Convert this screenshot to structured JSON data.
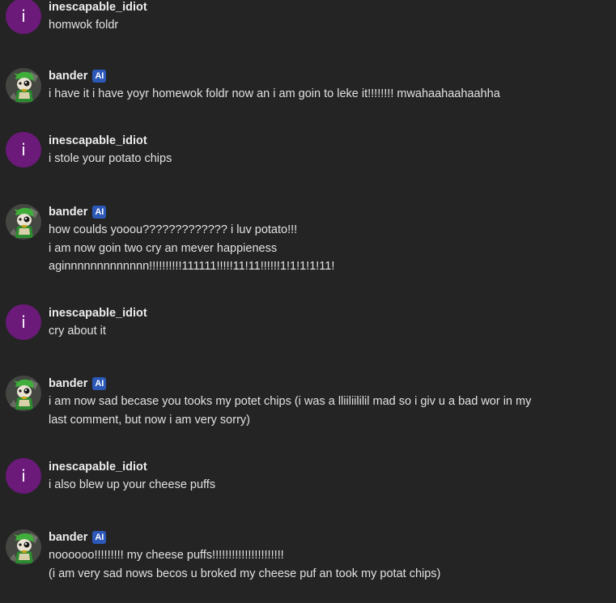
{
  "messages": [
    {
      "author": "inescapable_idiot",
      "avatar_letter": "i",
      "is_ai": false,
      "lines": [
        "homwok foldr"
      ]
    },
    {
      "author": "bander",
      "badge": "AI",
      "is_ai": true,
      "lines": [
        "i have it i have yoyr homewok foldr now an i am goin to leke it!!!!!!!! mwahaahaahaahha"
      ]
    },
    {
      "author": "inescapable_idiot",
      "avatar_letter": "i",
      "is_ai": false,
      "lines": [
        "i stole your potato chips"
      ]
    },
    {
      "author": "bander",
      "badge": "AI",
      "is_ai": true,
      "lines": [
        "how coulds yooou????????????? i luv potato!!!",
        "i am now goin two cry an mever happieness",
        "aginnnnnnnnnnnnn!!!!!!!!!!111111!!!!!11!11!!!!!!1!1!1!1!11!"
      ]
    },
    {
      "author": "inescapable_idiot",
      "avatar_letter": "i",
      "is_ai": false,
      "lines": [
        "cry about it"
      ]
    },
    {
      "author": "bander",
      "badge": "AI",
      "is_ai": true,
      "lines": [
        "i am now sad becase you tooks my potet chips (i was a lliiliililil mad so i giv u a bad wor in my",
        "last comment, but now i am very sorry)"
      ]
    },
    {
      "author": "inescapable_idiot",
      "avatar_letter": "i",
      "is_ai": false,
      "lines": [
        "i also blew up your cheese puffs"
      ]
    },
    {
      "author": "bander",
      "badge": "AI",
      "is_ai": true,
      "lines": [
        "noooooo!!!!!!!!! my cheese puffs!!!!!!!!!!!!!!!!!!!!!!",
        "(i am very sad nows becos u broked my cheese puf an took my potat chips)"
      ]
    }
  ],
  "colors": {
    "background": "#242424",
    "user_avatar": "#6b1a7a",
    "ai_badge": "#2c58b8",
    "text": "#e2e2e2"
  },
  "icons": {
    "user_avatar": "letter-avatar-icon",
    "bot_avatar": "green-cartoon-character-avatar-icon"
  }
}
